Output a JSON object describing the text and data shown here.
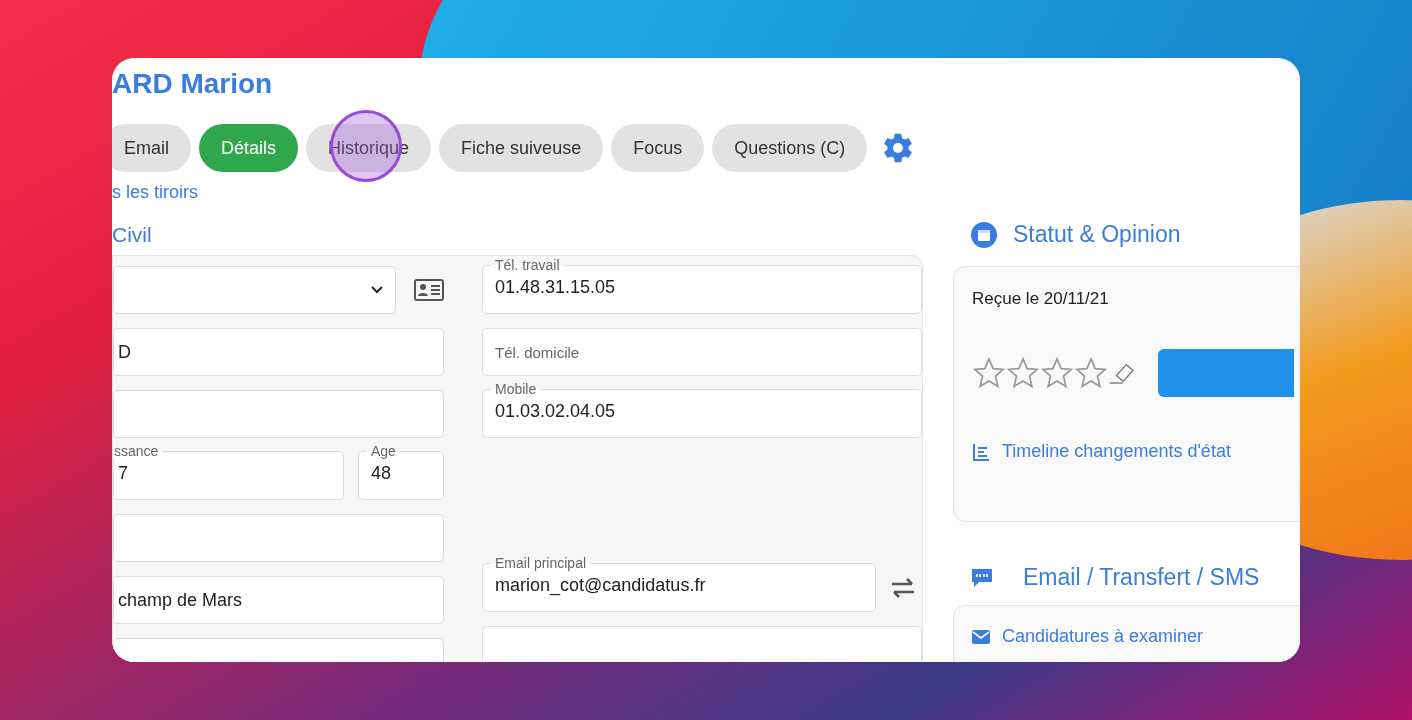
{
  "title": "ARD Marion",
  "tabs": [
    {
      "label": "Email",
      "selected": false
    },
    {
      "label": "Détails",
      "selected": true
    },
    {
      "label": "Historique",
      "selected": false
    },
    {
      "label": "Fiche suiveuse",
      "selected": false
    },
    {
      "label": "Focus",
      "selected": false
    },
    {
      "label": "Questions (C)",
      "selected": false
    }
  ],
  "drawers_link": "s les tiroirs",
  "section_title": "Civil",
  "left_rows": [
    {
      "kind": "select"
    },
    {
      "kind": "input",
      "fields": [
        {
          "value": "D"
        }
      ]
    },
    {
      "kind": "empty"
    },
    {
      "kind": "pair",
      "fields": [
        {
          "label": "ssance",
          "value": "7"
        },
        {
          "label": "Age",
          "value": "48"
        }
      ]
    },
    {
      "kind": "empty"
    },
    {
      "kind": "input",
      "fields": [
        {
          "value": "champ de Mars"
        }
      ]
    },
    {
      "kind": "empty"
    }
  ],
  "right_rows": [
    {
      "kind": "input",
      "label": "Tél. travail",
      "value": "01.48.31.15.05"
    },
    {
      "kind": "placeholder",
      "placeholder": "Tél. domicile"
    },
    {
      "kind": "input",
      "label": "Mobile",
      "value": "01.03.02.04.05"
    },
    {
      "kind": "blank"
    },
    {
      "kind": "blank"
    },
    {
      "kind": "swap",
      "label": "Email principal",
      "value": "marion_cot@candidatus.fr"
    },
    {
      "kind": "input"
    }
  ],
  "status": {
    "title": "Statut & Opinion",
    "received": "Reçue le 20/11/21",
    "stars": 0,
    "timeline_link": "Timeline changements d'état"
  },
  "messaging": {
    "title": "Email / Transfert / SMS",
    "items": [
      "Candidatures à examiner"
    ]
  }
}
